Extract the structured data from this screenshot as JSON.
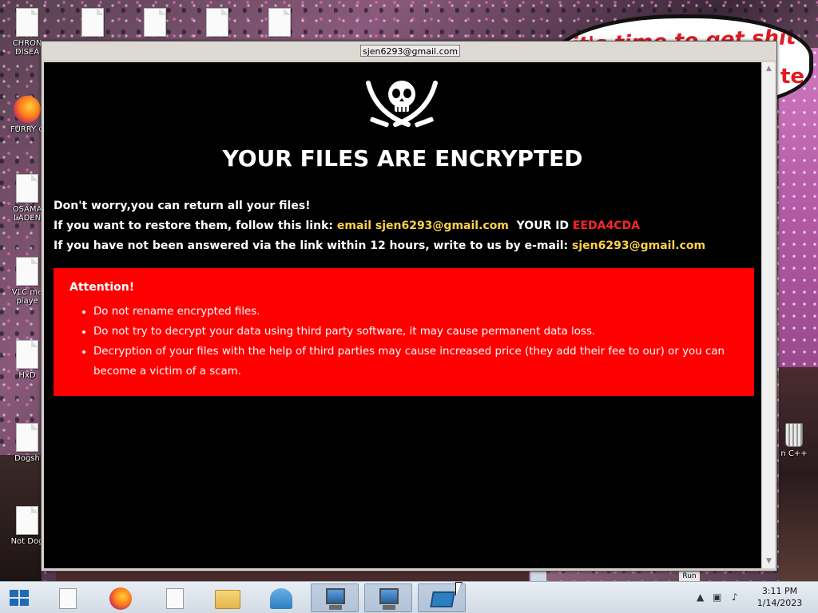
{
  "desktop": {
    "bubble_text": "it's time to get shit",
    "bubble_text_2": "te",
    "icons_left": [
      {
        "label": "CHRON\nDISEA"
      },
      {
        "label": "FURRY C"
      },
      {
        "label": "OSAMA\nLADEN"
      },
      {
        "label": "VLC me\nplaye"
      },
      {
        "label": "HxD"
      },
      {
        "label": "Dogsh"
      },
      {
        "label": "Not Dog"
      }
    ],
    "icon_right_label": "n C++",
    "icons": [
      "file-icon",
      "firefox-icon",
      "file-icon",
      "recycle-bin-icon"
    ]
  },
  "ransom_window": {
    "title": "sjen6293@gmail.com",
    "heading": "YOUR FILES ARE ENCRYPTED",
    "line1": "Don't worry,you can return all your files!",
    "line2_prefix": "If you want to restore them, follow this link: ",
    "line2_email": "email sjen6293@gmail.com",
    "line2_id_label": "  YOUR ID ",
    "line2_id": "EEDA4CDA",
    "line3_prefix": "If you have not been answered via the link within 12 hours, write to us by e-mail: ",
    "line3_email": "sjen6293@gmail.com",
    "attention_title": "Attention!",
    "bullets": [
      "Do not rename encrypted files.",
      "Do not try to decrypt your data using third party software, it may cause permanent data loss.",
      "Decryption of your files with the help of third parties may cause increased price (they add their fee to our) or you can become a victim of a scam."
    ],
    "colors": {
      "background": "#000000",
      "attention_box": "#ff0000",
      "highlight": "#ffd24a",
      "id_color": "#ff2626"
    }
  },
  "behind": {
    "run_label": "Run"
  },
  "taskbar": {
    "items": [
      "windows-start-icon",
      "file-icon",
      "firefox-icon",
      "file-icon",
      "file-explorer-icon",
      "network-icon",
      "computer-icon",
      "computer-icon",
      "window-icon"
    ],
    "clock_time": "3:11 PM",
    "clock_date": "1/14/2023",
    "tray_icons": [
      "show-hidden-icons-icon",
      "network-tray-icon",
      "volume-icon"
    ]
  }
}
